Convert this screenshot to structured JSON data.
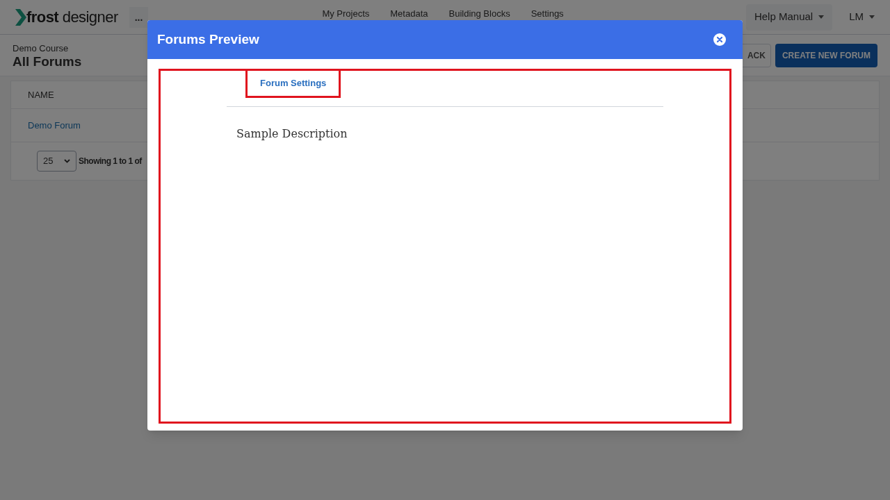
{
  "navbar": {
    "logo": {
      "word_1": "frost",
      "word_2": "designer"
    },
    "more": "...",
    "links": [
      "My Projects",
      "Metadata",
      "Building Blocks",
      "Settings"
    ],
    "help": "Help Manual",
    "user": "LM"
  },
  "header": {
    "course": "Demo Course",
    "title": "All Forums",
    "buttons": [
      {
        "label": "ACK",
        "kind": "outline"
      },
      {
        "label": "CREATE NEW FORUM",
        "kind": "primary"
      }
    ]
  },
  "table": {
    "columns": [
      "NAME"
    ],
    "rows": [
      [
        "Demo Forum"
      ]
    ],
    "page_size": "25",
    "summary": "Showing 1 to 1 of"
  },
  "modal": {
    "title": "Forums Preview",
    "tabs": [
      {
        "label": "Forum Settings",
        "selected": true
      }
    ],
    "description": "Sample Description"
  }
}
